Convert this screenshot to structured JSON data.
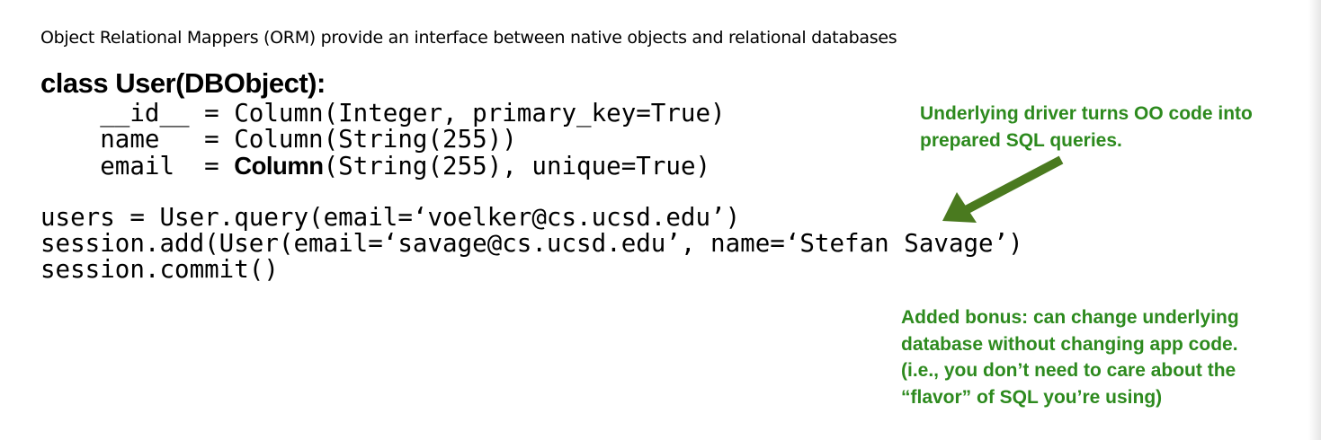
{
  "slide": {
    "intro_text": "Object Relational Mappers (ORM) provide an interface between native objects and relational databases",
    "class_header": "class User(DBObject):",
    "field_lines": [
      "    __id__ = Column(Integer, primary_key=True)",
      "    name   = Column(String(255))",
      "    email  = "
    ],
    "email_line_bold_word": "Column",
    "email_line_rest": "(String(255), unique=True)",
    "usage_lines": [
      "users = User.query(email=‘voelker@cs.ucsd.edu’)",
      "session.add(User(email=‘savage@cs.ucsd.edu’, name=‘Stefan Savage’)",
      "session.commit()"
    ],
    "driver_note": [
      "Underlying driver turns OO code into",
      "prepared SQL queries."
    ],
    "bonus_note": [
      "Added bonus: can change underlying",
      "database without changing app code.",
      "(i.e., you don’t need to care about the",
      "“flavor” of SQL you’re using)"
    ]
  },
  "colors": {
    "annotation_text": "#2d8a1e",
    "arrow": "#4a7a1f"
  },
  "icons": {
    "pointer": "arrow-icon"
  }
}
